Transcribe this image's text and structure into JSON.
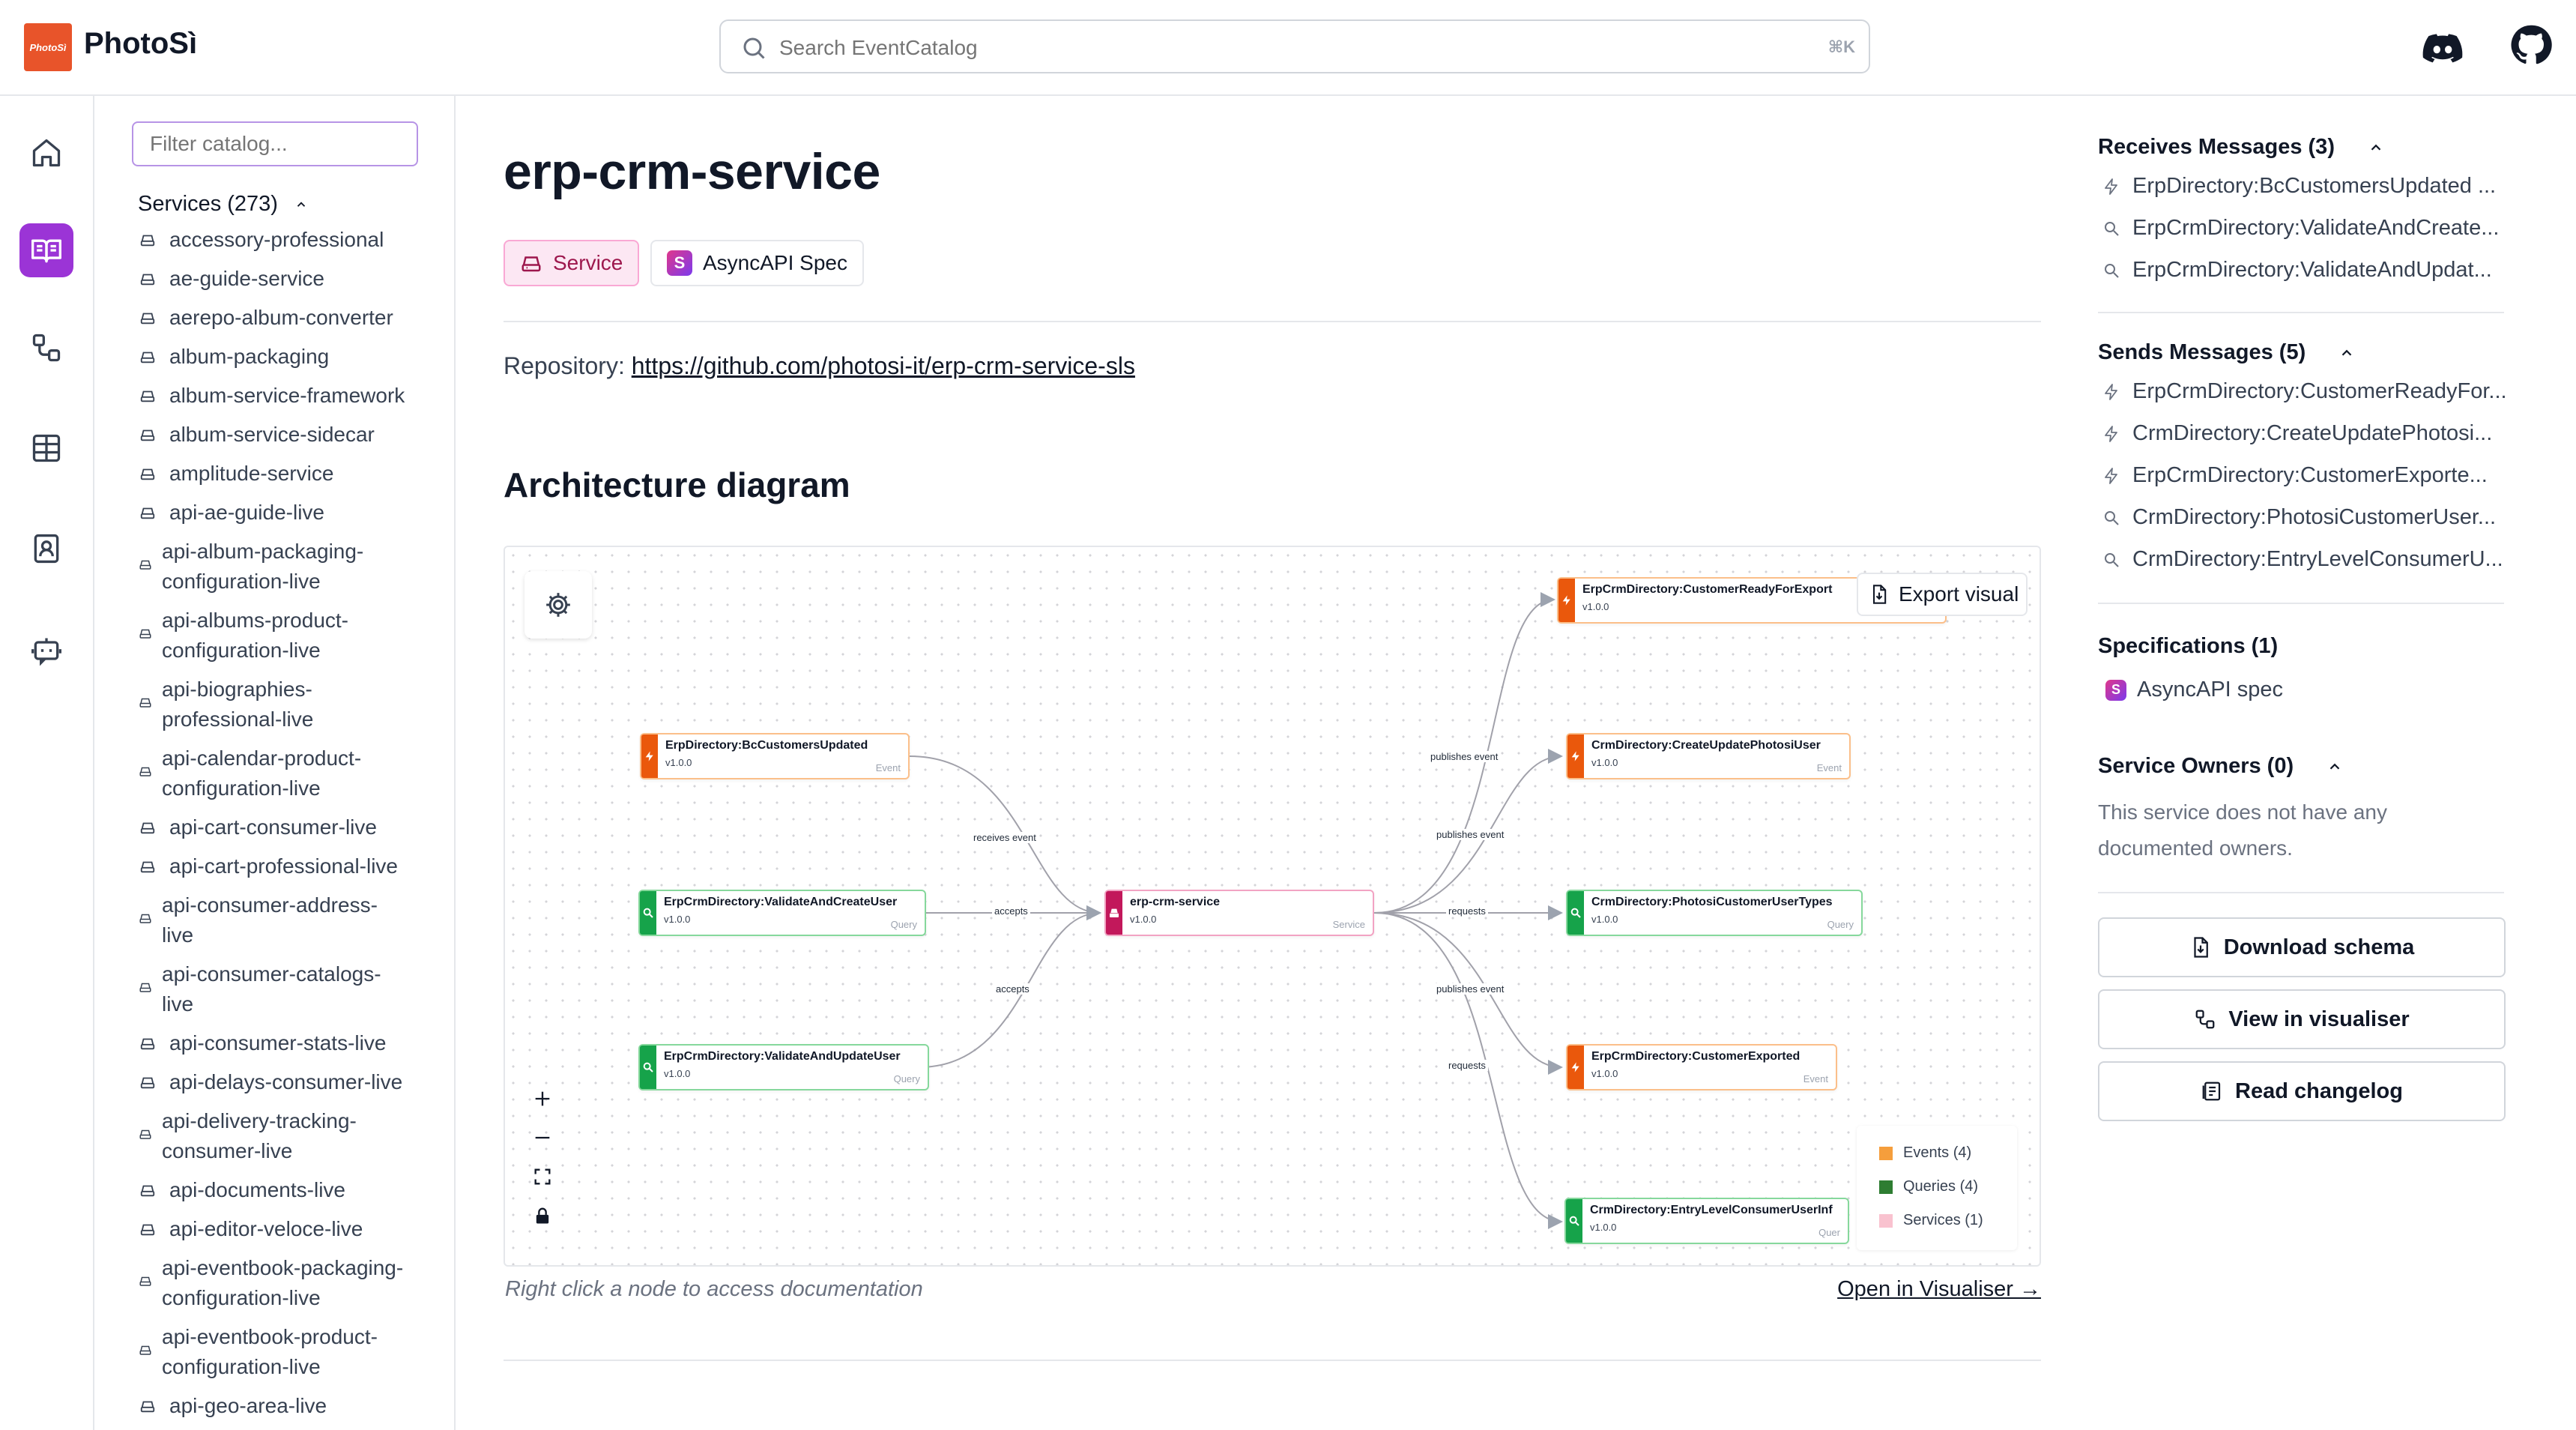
{
  "header": {
    "logo_text": "PhotoSì",
    "brand": "PhotoSì",
    "search_placeholder": "Search EventCatalog",
    "search_shortcut": "⌘K",
    "icons": [
      "search-icon",
      "discord-icon",
      "github-icon"
    ]
  },
  "rail": {
    "items": [
      "home-icon",
      "docs-icon",
      "visualiser-icon",
      "table-icon",
      "directory-icon",
      "chat-bot-icon"
    ],
    "active_index": 1,
    "active_color": "#9b34d6"
  },
  "sidebar": {
    "filter_placeholder": "Filter catalog...",
    "services_heading": "Services (273)",
    "services": [
      "accessory-professional",
      "ae-guide-service",
      "aerepo-album-converter",
      "album-packaging",
      "album-service-framework",
      "album-service-sidecar",
      "amplitude-service",
      "api-ae-guide-live",
      "api-album-packaging-configuration-live",
      "api-albums-product-configuration-live",
      "api-biographies-professional-live",
      "api-calendar-product-configuration-live",
      "api-cart-consumer-live",
      "api-cart-professional-live",
      "api-consumer-address-live",
      "api-consumer-catalogs-live",
      "api-consumer-stats-live",
      "api-delays-consumer-live",
      "api-delivery-tracking-consumer-live",
      "api-documents-live",
      "api-editor-veloce-live",
      "api-eventbook-packaging-configuration-live",
      "api-eventbook-product-configuration-live",
      "api-geo-area-live"
    ],
    "services_display": [
      [
        "accessory-professional"
      ],
      [
        "ae-guide-service"
      ],
      [
        "aerepo-album-converter"
      ],
      [
        "album-packaging"
      ],
      [
        "album-service-framework"
      ],
      [
        "album-service-sidecar"
      ],
      [
        "amplitude-service"
      ],
      [
        "api-ae-guide-live"
      ],
      [
        "api-album-packaging-",
        "configuration-live"
      ],
      [
        "api-albums-product-",
        "configuration-live"
      ],
      [
        "api-biographies-",
        "professional-live"
      ],
      [
        "api-calendar-product-",
        "configuration-live"
      ],
      [
        "api-cart-consumer-live"
      ],
      [
        "api-cart-professional-live"
      ],
      [
        "api-consumer-address-",
        "live"
      ],
      [
        "api-consumer-catalogs-",
        "live"
      ],
      [
        "api-consumer-stats-live"
      ],
      [
        "api-delays-consumer-live"
      ],
      [
        "api-delivery-tracking-",
        "consumer-live"
      ],
      [
        "api-documents-live"
      ],
      [
        "api-editor-veloce-live"
      ],
      [
        "api-eventbook-packaging-",
        "configuration-live"
      ],
      [
        "api-eventbook-product-",
        "configuration-live"
      ],
      [
        "api-geo-area-live"
      ]
    ]
  },
  "main": {
    "title": "erp-crm-service",
    "badges": {
      "service": "Service",
      "spec": "AsyncAPI Spec"
    },
    "repository_label": "Repository: ",
    "repository_url": "https://github.com/photosi-it/erp-crm-service-sls",
    "architecture_heading": "Architecture diagram",
    "caption": "Right click a node to access documentation",
    "open_visualiser": "Open in Visualiser →"
  },
  "diagram": {
    "export_label": "Export visual",
    "colors": {
      "event": "#ea580c",
      "query": "#16a34a",
      "service": "#c2185b"
    },
    "center": {
      "name": "erp-crm-service",
      "version": "v1.0.0",
      "kind": "Service"
    },
    "incoming": [
      {
        "name": "ErpDirectory:BcCustomersUpdated",
        "version": "v1.0.0",
        "kind": "Event",
        "edge": "receives event"
      },
      {
        "name": "ErpCrmDirectory:ValidateAndCreateUser",
        "version": "v1.0.0",
        "kind": "Query",
        "edge": "accepts"
      },
      {
        "name": "ErpCrmDirectory:ValidateAndUpdateUser",
        "version": "v1.0.0",
        "kind": "Query",
        "edge": "accepts"
      }
    ],
    "outgoing": [
      {
        "name": "ErpCrmDirectory:CustomerReadyForExport",
        "version": "v1.0.0",
        "kind": "Event",
        "edge": "publishes event"
      },
      {
        "name": "CrmDirectory:CreateUpdatePhotosiUser",
        "version": "v1.0.0",
        "kind": "Event",
        "edge": "publishes event"
      },
      {
        "name": "CrmDirectory:PhotosiCustomerUserTypes",
        "version": "v1.0.0",
        "kind": "Query",
        "edge": "requests"
      },
      {
        "name": "ErpCrmDirectory:CustomerExported",
        "version": "v1.0.0",
        "kind": "Event",
        "edge": "publishes event"
      },
      {
        "name": "CrmDirectory:EntryLevelConsumerUserInf",
        "version": "v1.0.0",
        "kind": "Quer",
        "edge": "requests"
      }
    ],
    "legend": [
      {
        "label": "Events (4)",
        "color": "#f59e3c"
      },
      {
        "label": "Queries (4)",
        "color": "#2e7d32"
      },
      {
        "label": "Services (1)",
        "color": "#f9c2cf"
      }
    ]
  },
  "aside": {
    "receives_heading": "Receives Messages (3)",
    "receives": [
      {
        "label": "ErpDirectory:BcCustomersUpdated ...",
        "icon": "lightning-icon"
      },
      {
        "label": "ErpCrmDirectory:ValidateAndCreate...",
        "icon": "magnifier-icon"
      },
      {
        "label": "ErpCrmDirectory:ValidateAndUpdat...",
        "icon": "magnifier-icon"
      }
    ],
    "sends_heading": "Sends Messages (5)",
    "sends": [
      {
        "label": "ErpCrmDirectory:CustomerReadyFor...",
        "icon": "lightning-icon"
      },
      {
        "label": "CrmDirectory:CreateUpdatePhotosi...",
        "icon": "lightning-icon"
      },
      {
        "label": "ErpCrmDirectory:CustomerExporte...",
        "icon": "lightning-icon"
      },
      {
        "label": "CrmDirectory:PhotosiCustomerUser...",
        "icon": "magnifier-icon"
      },
      {
        "label": "CrmDirectory:EntryLevelConsumerU...",
        "icon": "magnifier-icon"
      }
    ],
    "specs_heading": "Specifications (1)",
    "spec_item": "AsyncAPI spec",
    "owners_heading": "Service Owners (0)",
    "owners_text": "This service does not have any documented owners.",
    "buttons": {
      "download": "Download schema",
      "visualiser": "View in visualiser",
      "changelog": "Read changelog"
    }
  }
}
